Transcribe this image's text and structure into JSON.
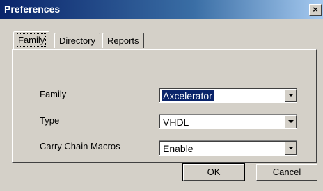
{
  "window": {
    "title": "Preferences",
    "close_label": "×"
  },
  "tabs": [
    {
      "label": "Family",
      "active": true
    },
    {
      "label": "Directory",
      "active": false
    },
    {
      "label": "Reports",
      "active": false
    }
  ],
  "fields": [
    {
      "label": "Family",
      "value": "Axcelerator",
      "selected": true
    },
    {
      "label": "Type",
      "value": "VHDL",
      "selected": false
    },
    {
      "label": "Carry Chain Macros",
      "value": "Enable",
      "selected": false
    }
  ],
  "buttons": {
    "ok_label": "OK",
    "cancel_label": "Cancel"
  },
  "icons": [
    "close-icon",
    "chevron-down-icon"
  ]
}
